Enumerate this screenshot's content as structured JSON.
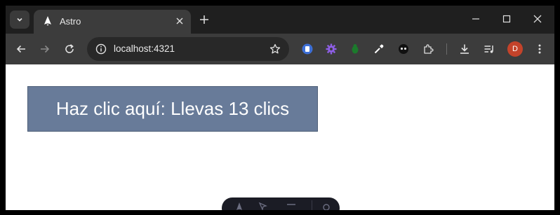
{
  "browser": {
    "tab": {
      "title": "Astro",
      "favicon": "astro-logo-icon"
    },
    "address": {
      "url": "localhost:4321"
    },
    "profile_initial": "D"
  },
  "page": {
    "counter_button_label": "Haz clic aquí: Llevas 13 clics"
  },
  "colors": {
    "button_bg": "#687b99",
    "avatar_bg": "#c4432a"
  }
}
